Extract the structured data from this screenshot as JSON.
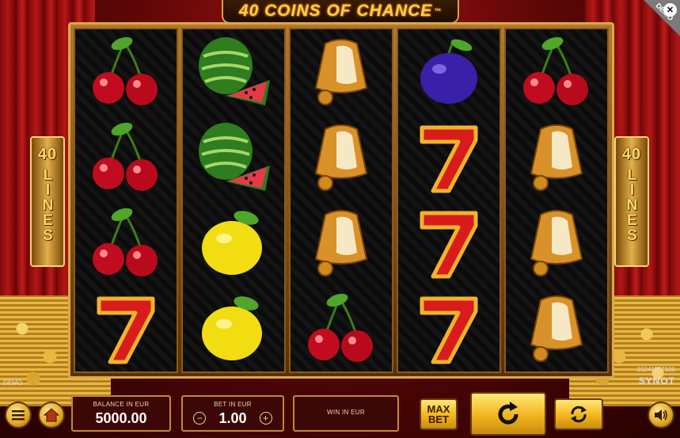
{
  "game": {
    "title": "40 COINS OF CHANCE",
    "title_tm": "™",
    "side_lines_number": "40",
    "side_lines_word": "LINES",
    "demo_ribbon": "DEMO",
    "demo_tag": "DEMO",
    "build": "20241107100",
    "brand": "SYNOT"
  },
  "reels": [
    [
      "cherry",
      "cherry",
      "cherry",
      "seven"
    ],
    [
      "watermelon",
      "watermelon",
      "lemon",
      "lemon"
    ],
    [
      "bell",
      "bell",
      "bell",
      "cherry"
    ],
    [
      "plum",
      "seven",
      "seven",
      "seven"
    ],
    [
      "cherry",
      "bell",
      "bell",
      "bell"
    ]
  ],
  "hud": {
    "balance_label": "BALANCE IN EUR",
    "balance_value": "5000.00",
    "bet_label": "BET IN EUR",
    "bet_value": "1.00",
    "win_label": "WIN IN EUR",
    "win_value": "",
    "maxbet_line1": "MAX",
    "maxbet_line2": "BET",
    "minus": "−",
    "plus": "+"
  },
  "colors": {
    "accent_gold": "#f2b51d",
    "panel": "#3c0707",
    "curtain": "#b51616"
  },
  "icons": {
    "menu": "hamburger-icon",
    "home": "home-icon",
    "spin": "refresh-arrow-icon",
    "autoplay": "autoplay-icon",
    "sound": "speaker-icon",
    "close": "close-icon"
  }
}
